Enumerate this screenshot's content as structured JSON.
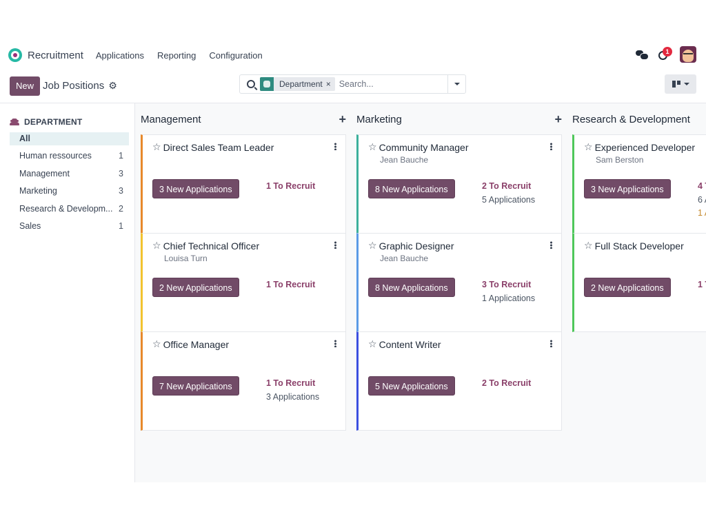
{
  "app": {
    "name": "Recruitment",
    "menu": [
      "Applications",
      "Reporting",
      "Configuration"
    ],
    "notifications_count": "1"
  },
  "control_panel": {
    "new_label": "New",
    "title": "Job Positions",
    "search": {
      "facet_label": "Department",
      "facet_close": "×",
      "placeholder": "Search..."
    }
  },
  "sidebar": {
    "heading": "DEPARTMENT",
    "items": [
      {
        "label": "All",
        "count": ""
      },
      {
        "label": "Human ressources",
        "count": "1"
      },
      {
        "label": "Management",
        "count": "3"
      },
      {
        "label": "Marketing",
        "count": "3"
      },
      {
        "label": "Research & Developm...",
        "count": "2"
      },
      {
        "label": "Sales",
        "count": "1"
      }
    ]
  },
  "columns": [
    {
      "title": "Management",
      "add": "+",
      "cards": [
        {
          "title": "Direct Sales Team Leader",
          "subtitle": "",
          "button": "3 New Applications",
          "to_recruit": "1 To Recruit",
          "applications": "",
          "late": "",
          "color": "#e8892b"
        },
        {
          "title": "Chief Technical Officer",
          "subtitle": "Louisa Turn",
          "button": "2 New Applications",
          "to_recruit": "1 To Recruit",
          "applications": "",
          "late": "",
          "color": "#f2c32f"
        },
        {
          "title": "Office Manager",
          "subtitle": "",
          "button": "7 New Applications",
          "to_recruit": "1 To Recruit",
          "applications": "3 Applications",
          "late": "",
          "color": "#e8892b"
        }
      ]
    },
    {
      "title": "Marketing",
      "add": "+",
      "cards": [
        {
          "title": "Community Manager",
          "subtitle": "Jean Bauche",
          "button": "8 New Applications",
          "to_recruit": "2 To Recruit",
          "applications": "5 Applications",
          "late": "",
          "color": "#3cb09c"
        },
        {
          "title": "Graphic Designer",
          "subtitle": "Jean Bauche",
          "button": "8 New Applications",
          "to_recruit": "3 To Recruit",
          "applications": "1 Applications",
          "late": "",
          "color": "#5b9be6"
        },
        {
          "title": "Content Writer",
          "subtitle": "",
          "button": "5 New Applications",
          "to_recruit": "2 To Recruit",
          "applications": "",
          "late": "",
          "color": "#3b4fe0"
        }
      ]
    },
    {
      "title": "Research & Development",
      "add": "",
      "cards": [
        {
          "title": "Experienced Developer",
          "subtitle": "Sam Berston",
          "button": "3 New Applications",
          "to_recruit": "4 T",
          "applications": "6 A",
          "late": "1 A",
          "color": "#4fc75a"
        },
        {
          "title": "Full Stack Developer",
          "subtitle": "",
          "button": "2 New Applications",
          "to_recruit": "1 T",
          "applications": "",
          "late": "",
          "color": "#4fc75a"
        }
      ]
    }
  ]
}
